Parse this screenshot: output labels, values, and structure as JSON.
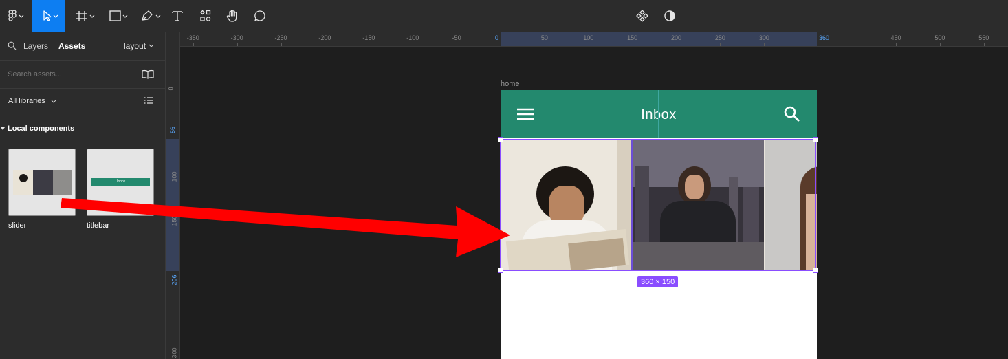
{
  "toolbar": {
    "tools": [
      "main-menu",
      "move",
      "frame",
      "shape",
      "pen",
      "text",
      "resources",
      "hand",
      "comment"
    ],
    "right_tools": [
      "components",
      "dark-mode"
    ]
  },
  "left_panel": {
    "tabs": {
      "layers": "Layers",
      "assets": "Assets"
    },
    "page_select": "layout",
    "search_placeholder": "Search assets...",
    "library_filter": "All libraries",
    "section_title": "Local components",
    "components": [
      {
        "label": "slider"
      },
      {
        "label": "titlebar"
      }
    ],
    "titlebar_thumb_text": "Inbox"
  },
  "ruler": {
    "top_ticks": [
      "-350",
      "-300",
      "-250",
      "-200",
      "-150",
      "-100",
      "-50",
      "0",
      "50",
      "100",
      "150",
      "200",
      "250",
      "300",
      "360",
      "450",
      "500",
      "550"
    ],
    "left_ticks": [
      "0",
      "56",
      "100",
      "150",
      "206",
      "300"
    ]
  },
  "canvas": {
    "frame_name": "home",
    "titlebar": {
      "title": "Inbox"
    },
    "selection_size": "360 × 150"
  },
  "colors": {
    "accent_blue": "#0d7ef2",
    "titlebar_green": "#23896e",
    "selection_purple": "#8a4dff",
    "annotation_red": "#ff0000"
  }
}
